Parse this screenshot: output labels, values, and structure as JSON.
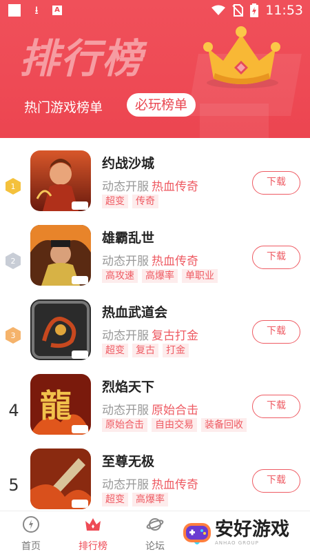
{
  "status_bar": {
    "time": "11:53"
  },
  "header": {
    "big_title": "排行榜",
    "tab_hot": "热门游戏榜单",
    "tab_must": "必玩榜单"
  },
  "games": [
    {
      "rank": "1",
      "name": "约战沙城",
      "mode": "动态开服",
      "genre": "热血传奇",
      "tags": [
        "超变",
        "传奇"
      ],
      "download": "下载"
    },
    {
      "rank": "2",
      "name": "雄霸乱世",
      "mode": "动态开服",
      "genre": "热血传奇",
      "tags": [
        "高攻速",
        "高爆率",
        "单职业"
      ],
      "download": "下载"
    },
    {
      "rank": "3",
      "name": "热血武道会",
      "mode": "动态开服",
      "genre": "复古打金",
      "tags": [
        "超变",
        "复古",
        "打金"
      ],
      "download": "下载"
    },
    {
      "rank": "4",
      "name": "烈焰天下",
      "mode": "动态开服",
      "genre": "原始合击",
      "tags": [
        "原始合击",
        "自由交易",
        "装备回收"
      ],
      "download": "下载"
    },
    {
      "rank": "5",
      "name": "至尊无极",
      "mode": "动态开服",
      "genre": "热血传奇",
      "tags": [
        "超变",
        "高爆率"
      ],
      "download": "下载"
    }
  ],
  "bottom_nav": {
    "home": "首页",
    "ranking": "排行榜",
    "forum": "论坛"
  },
  "watermark": {
    "main": "安好游戏",
    "sub": "ANHAO GROUP"
  },
  "colors": {
    "accent": "#ee4a55",
    "tag_bg": "#fdecec"
  }
}
